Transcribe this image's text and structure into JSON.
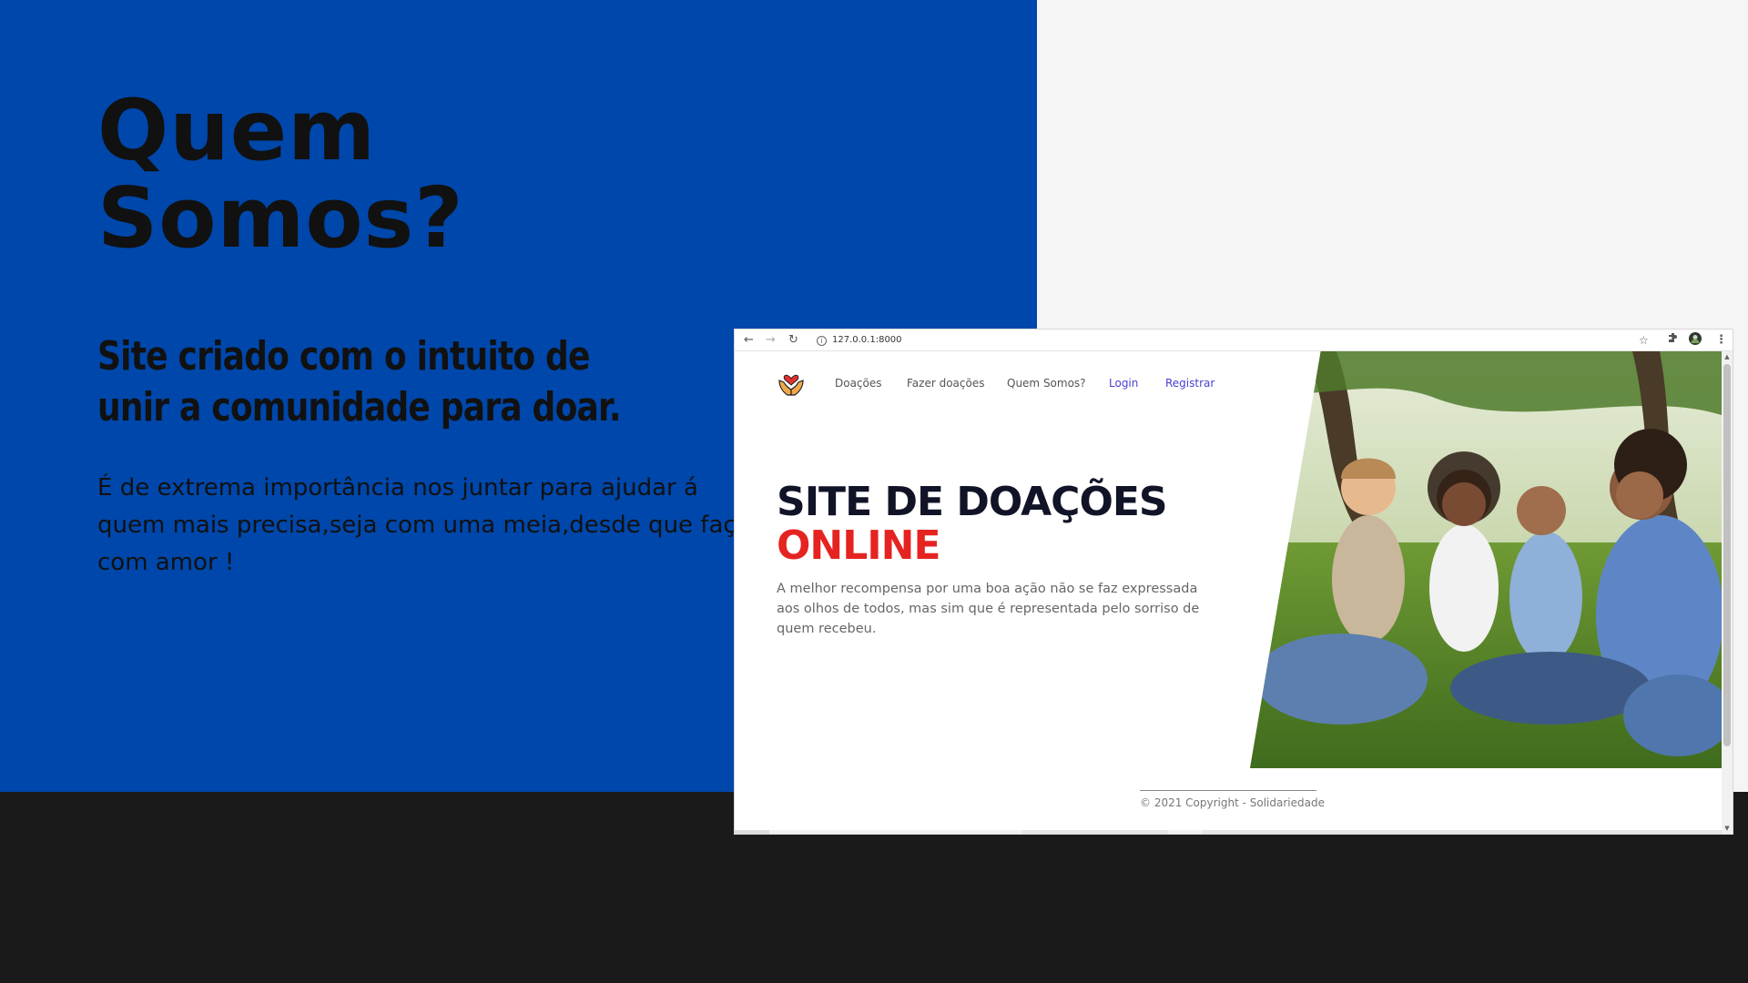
{
  "slide": {
    "title_line1": "Quem",
    "title_line2": "Somos?",
    "subtitle": "Site criado com o intuito de unir a comunidade para doar.",
    "body": "É de extrema importância nos juntar para ajudar á quem mais precisa,seja com uma meia,desde que faça com amor !"
  },
  "browser": {
    "url": "127.0.0.1:8000",
    "icons": [
      "back-arrow-icon",
      "forward-arrow-icon",
      "reload-icon",
      "info-icon",
      "star-icon",
      "extensions-icon",
      "profile-icon",
      "menu-dots-icon"
    ]
  },
  "navbar": {
    "items": [
      {
        "label": "Doações"
      },
      {
        "label": "Fazer doações"
      },
      {
        "label": "Quem Somos?"
      },
      {
        "label": "Login"
      },
      {
        "label": "Registrar"
      }
    ]
  },
  "hero": {
    "title": "SITE DE DOAÇÕES",
    "title_highlight": "ONLINE",
    "text": "A melhor recompensa por uma boa ação não se faz expressada aos olhos de todos, mas sim que é representada pelo sorriso de quem recebeu."
  },
  "footer": {
    "text": "© 2021 Copyright - Solidariedade"
  },
  "colors": {
    "slide_blue": "#0047AB",
    "dark_band": "#1a1a1a",
    "hero_red": "#e52320",
    "nav_accent": "#4a3fd1"
  }
}
